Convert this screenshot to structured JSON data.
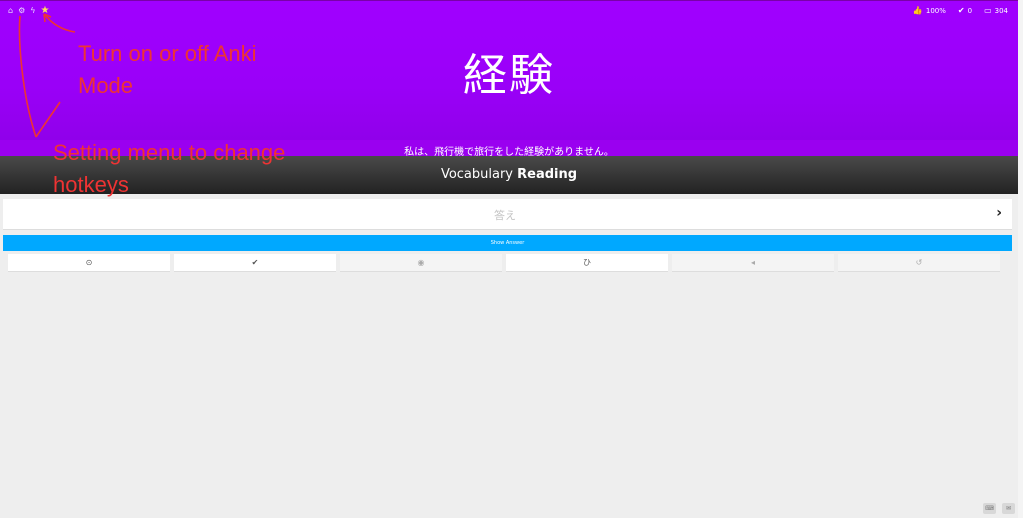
{
  "header": {
    "icons": [
      "home-icon",
      "gear-icon",
      "lightning-icon",
      "star-icon"
    ],
    "stats": {
      "accuracy": "100%",
      "correct": "0",
      "remaining": "304"
    }
  },
  "item": {
    "character": "経験",
    "sentence": "私は、飛行機で旅行をした経験がありません。",
    "question_type_prefix": "Vocabulary",
    "question_type_emphasis": "Reading"
  },
  "answer": {
    "placeholder": "答え"
  },
  "show_answer_label": "Show Answer",
  "additional_buttons": [
    {
      "icon": "clock-icon",
      "glyph": "⊙"
    },
    {
      "icon": "check-icon",
      "glyph": "✔"
    },
    {
      "icon": "eye-icon",
      "glyph": "◉"
    },
    {
      "icon": "kana-icon",
      "glyph": "ひ"
    },
    {
      "icon": "audio-icon",
      "glyph": "◂"
    },
    {
      "icon": "undo-icon",
      "glyph": "↺"
    }
  ],
  "annotations": {
    "anki_line1": "Turn on or off Anki",
    "anki_line2": "Mode",
    "settings_line1": "Setting menu to change",
    "settings_line2": "hotkeys"
  },
  "colors": {
    "purple": "#a000ff",
    "blue_button": "#00a8ff",
    "annotation_red": "#e33333"
  }
}
